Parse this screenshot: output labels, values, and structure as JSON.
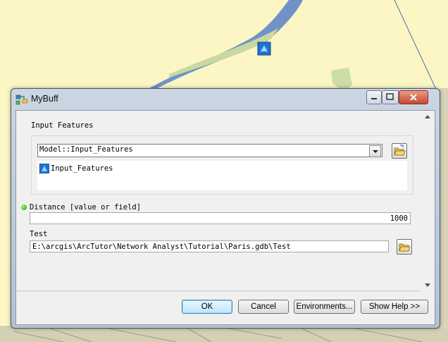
{
  "window": {
    "title": "MyBuff"
  },
  "form": {
    "input_features": {
      "label": "Input Features",
      "selected_value": "Model::Input_Features",
      "list_item": "Input_Features"
    },
    "distance": {
      "label": "Distance [value or field]",
      "value": "1000"
    },
    "test": {
      "label": "Test",
      "value": "E:\\arcgis\\ArcTutor\\Network Analyst\\Tutorial\\Paris.gdb\\Test"
    }
  },
  "buttons": {
    "ok": "OK",
    "cancel": "Cancel",
    "environments": "Environments...",
    "show_help": "Show Help >>"
  },
  "icons": {
    "title": "model-tool-icon",
    "feature": "feature-class-icon",
    "browse": "open-folder-icon",
    "required": "green-dot-icon"
  },
  "colors": {
    "map_background": "#fbf6c4",
    "river": "#5f88c8",
    "ok_button": "#bee6fd"
  }
}
